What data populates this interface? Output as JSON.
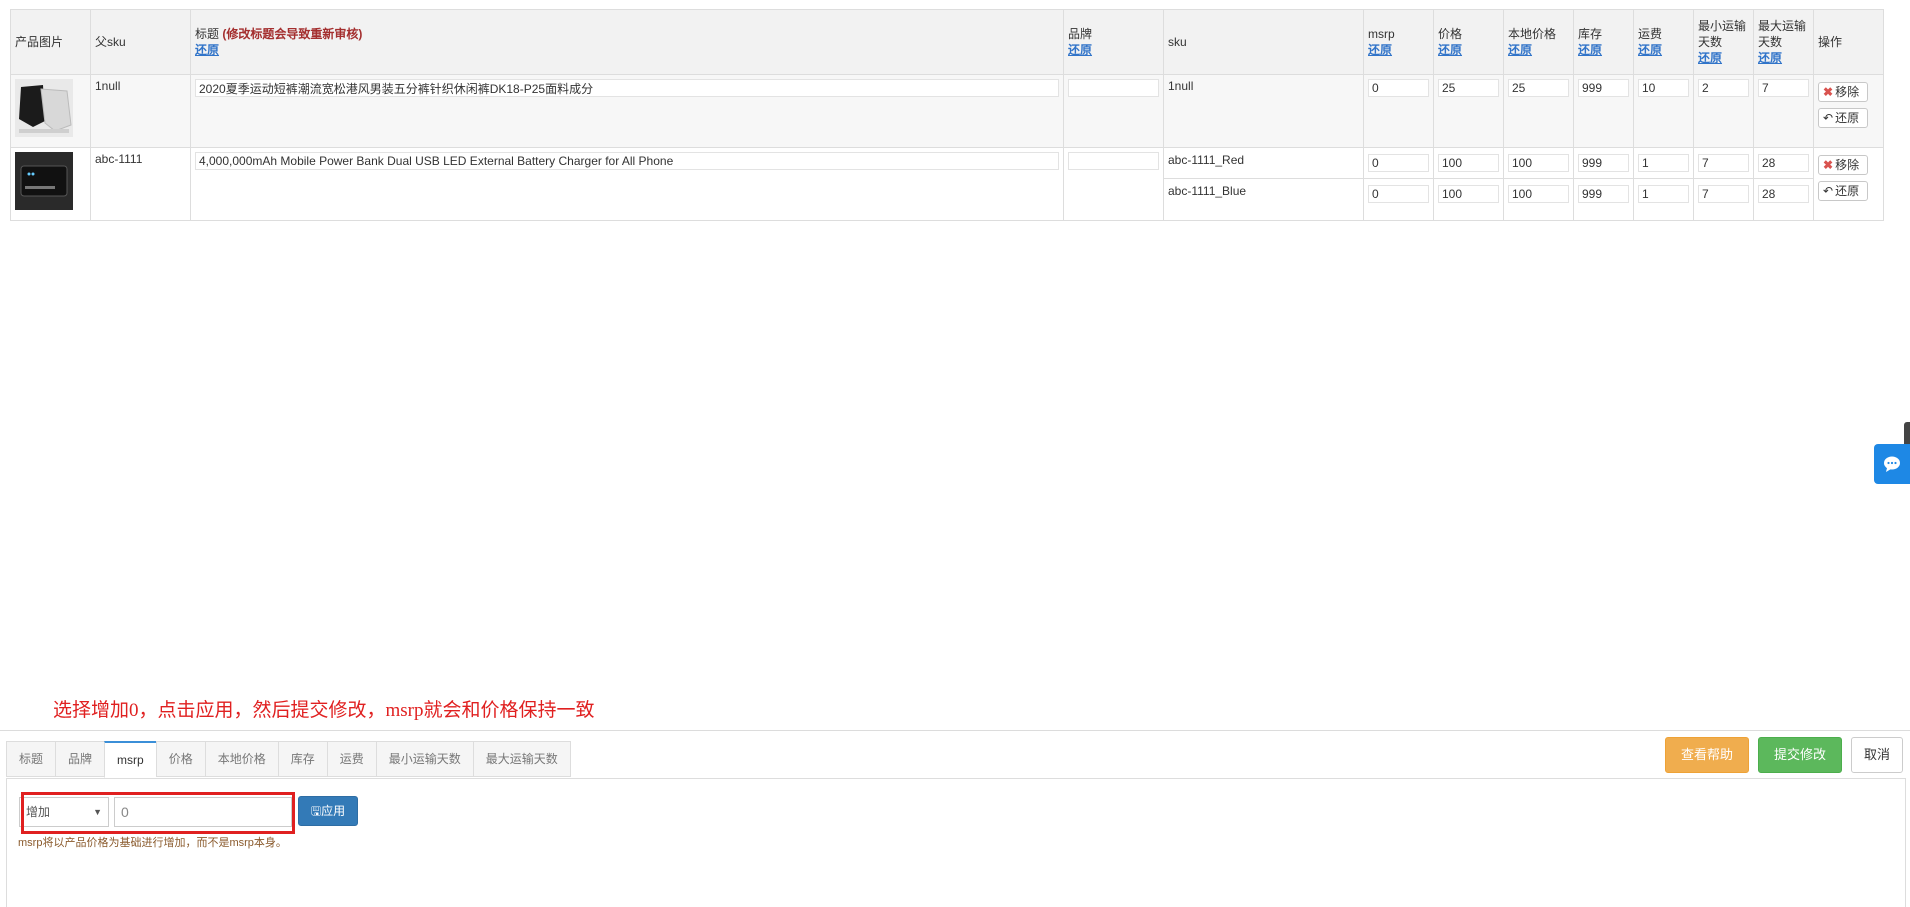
{
  "table": {
    "headers": {
      "image": "产品图片",
      "parent_sku": "父sku",
      "title": "标题",
      "title_warning": "(修改标题会导致重新审核)",
      "title_restore": "还原",
      "brand": "品牌",
      "brand_restore": "还原",
      "sku": "sku",
      "msrp": "msrp",
      "msrp_restore": "还原",
      "price": "价格",
      "price_restore": "还原",
      "local_price": "本地价格",
      "local_price_restore": "还原",
      "stock": "库存",
      "stock_restore": "还原",
      "shipping": "运费",
      "shipping_restore": "还原",
      "min_days": "最小运输天数",
      "min_days_restore": "还原",
      "max_days": "最大运输天数",
      "max_days_restore": "还原",
      "actions": "操作"
    },
    "rows": [
      {
        "parent_sku": "1null",
        "title": "2020夏季运动短裤潮流宽松港风男装五分裤针织休闲裤DK18-P25面料成分",
        "brand": "",
        "variants": [
          {
            "sku": "1null",
            "msrp": "0",
            "price": "25",
            "local_price": "25",
            "stock": "999",
            "shipping": "10",
            "min_days": "2",
            "max_days": "7"
          }
        ],
        "remove_label": "移除",
        "restore_label": "还原"
      },
      {
        "parent_sku": "abc-1111",
        "title": "4,000,000mAh Mobile Power Bank Dual USB LED External Battery Charger for All Phone",
        "brand": "",
        "variants": [
          {
            "sku": "abc-1111_Red",
            "msrp": "0",
            "price": "100",
            "local_price": "100",
            "stock": "999",
            "shipping": "1",
            "min_days": "7",
            "max_days": "28"
          },
          {
            "sku": "abc-1111_Blue",
            "msrp": "0",
            "price": "100",
            "local_price": "100",
            "stock": "999",
            "shipping": "1",
            "min_days": "7",
            "max_days": "28"
          }
        ],
        "remove_label": "移除",
        "restore_label": "还原"
      }
    ]
  },
  "annotation": "选择增加0，点击应用，然后提交修改，msrp就会和价格保持一致",
  "bottom": {
    "tabs": [
      "标题",
      "品牌",
      "msrp",
      "价格",
      "本地价格",
      "库存",
      "运费",
      "最小运输天数",
      "最大运输天数"
    ],
    "active_tab": "msrp",
    "help_label": "查看帮助",
    "submit_label": "提交修改",
    "cancel_label": "取消",
    "mode_value": "增加",
    "amount_value": "0",
    "apply_label": "应用",
    "hint": "msrp将以产品价格为基础进行增加，而不是msrp本身。"
  },
  "colors": {
    "accent_blue": "#337ab7",
    "help_orange": "#f0ad4e",
    "submit_green": "#5cb85c",
    "annotation_red": "#e02020",
    "chat_blue": "#1e88e5"
  }
}
